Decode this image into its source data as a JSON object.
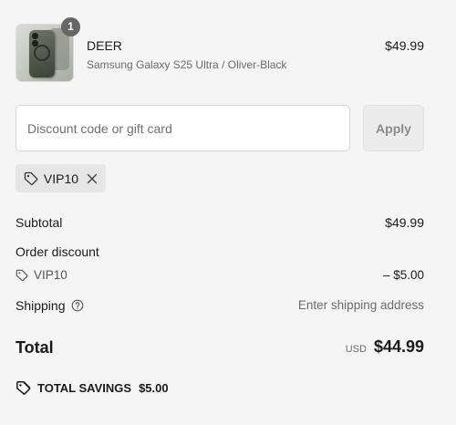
{
  "product": {
    "quantity": "1",
    "name": "DEER",
    "variant": "Samsung Galaxy S25 Ultra / Oliver-Black",
    "price": "$49.99",
    "image_icon": "phone-case-image"
  },
  "discount": {
    "placeholder": "Discount code or gift card",
    "value": "",
    "apply_label": "Apply",
    "applied_code": "VIP10"
  },
  "summary": {
    "subtotal_label": "Subtotal",
    "subtotal_value": "$49.99",
    "order_discount_label": "Order discount",
    "discount_code": "VIP10",
    "discount_value": "– $5.00",
    "shipping_label": "Shipping",
    "shipping_value": "Enter shipping address",
    "total_label": "Total",
    "currency": "USD",
    "total_value": "$44.99",
    "savings_label": "TOTAL SAVINGS",
    "savings_value": "$5.00"
  },
  "icons": {
    "tag": "tag-icon",
    "remove": "close-icon",
    "help": "question-circle-icon",
    "savings": "tag-double-icon"
  }
}
